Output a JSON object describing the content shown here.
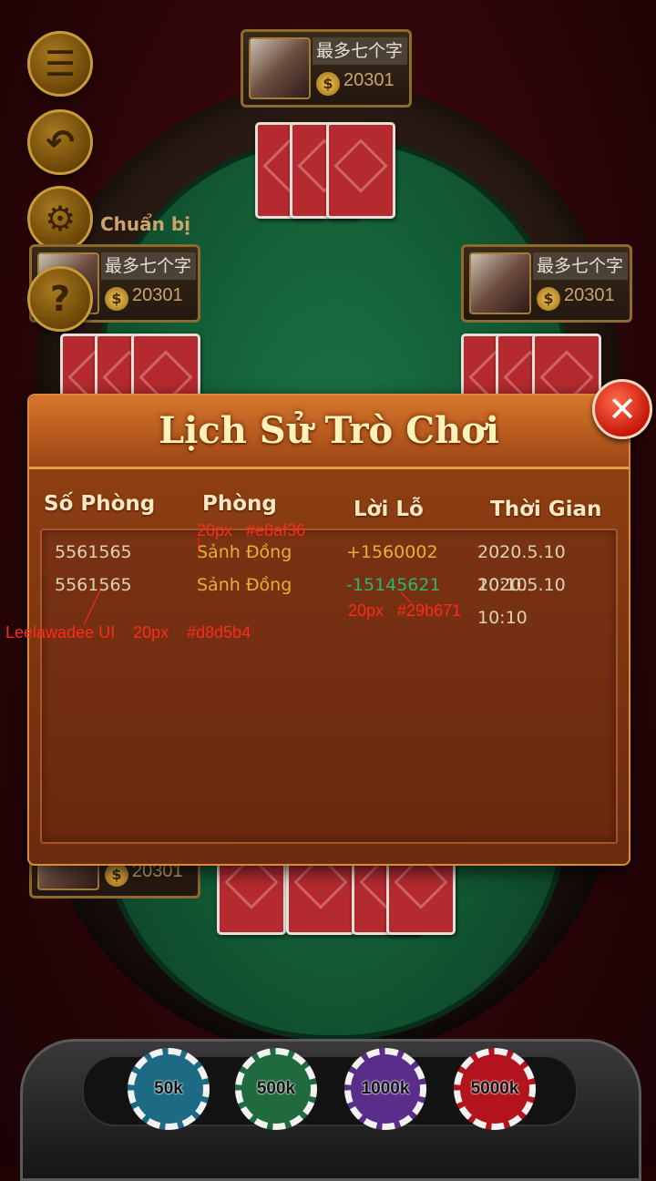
{
  "top_player": {
    "name": "最多七个字",
    "money": "20301"
  },
  "left_player": {
    "name": "最多七个字",
    "money": "20301",
    "status": "Chuẩn bị"
  },
  "right_player": {
    "name": "最多七个字",
    "money": "20301"
  },
  "bottom_player": {
    "money": "20301"
  },
  "chips": [
    {
      "label": "50k",
      "color": "#1d6a84"
    },
    {
      "label": "500k",
      "color": "#1f6a3f"
    },
    {
      "label": "1000k",
      "color": "#5b2d8a"
    },
    {
      "label": "5000k",
      "color": "#b3131d"
    }
  ],
  "modal": {
    "title": "Lịch Sử Trò Chơi",
    "columns": [
      "Số Phòng",
      "Phòng",
      "Lời Lỗ",
      "Thời Gian"
    ],
    "rows": [
      {
        "room": "5561565",
        "name": "Sảnh Đồng",
        "profit": "+1560002",
        "time": "2020.5.10  10:10"
      },
      {
        "room": "5561565",
        "name": "Sảnh Đồng",
        "profit": "-15145621",
        "time": "2020.5.10  10:10"
      }
    ]
  },
  "colors": {
    "room_text": "#d8d5b4",
    "name_text": "#e8af36",
    "profit_positive": "#e8af36",
    "profit_negative": "#29b671"
  },
  "annotations": {
    "name_spec": "20px   #e8af36",
    "profit_spec": "20px   #29b671",
    "room_spec": "Leelawadee UI    20px    #d8d5b4"
  }
}
